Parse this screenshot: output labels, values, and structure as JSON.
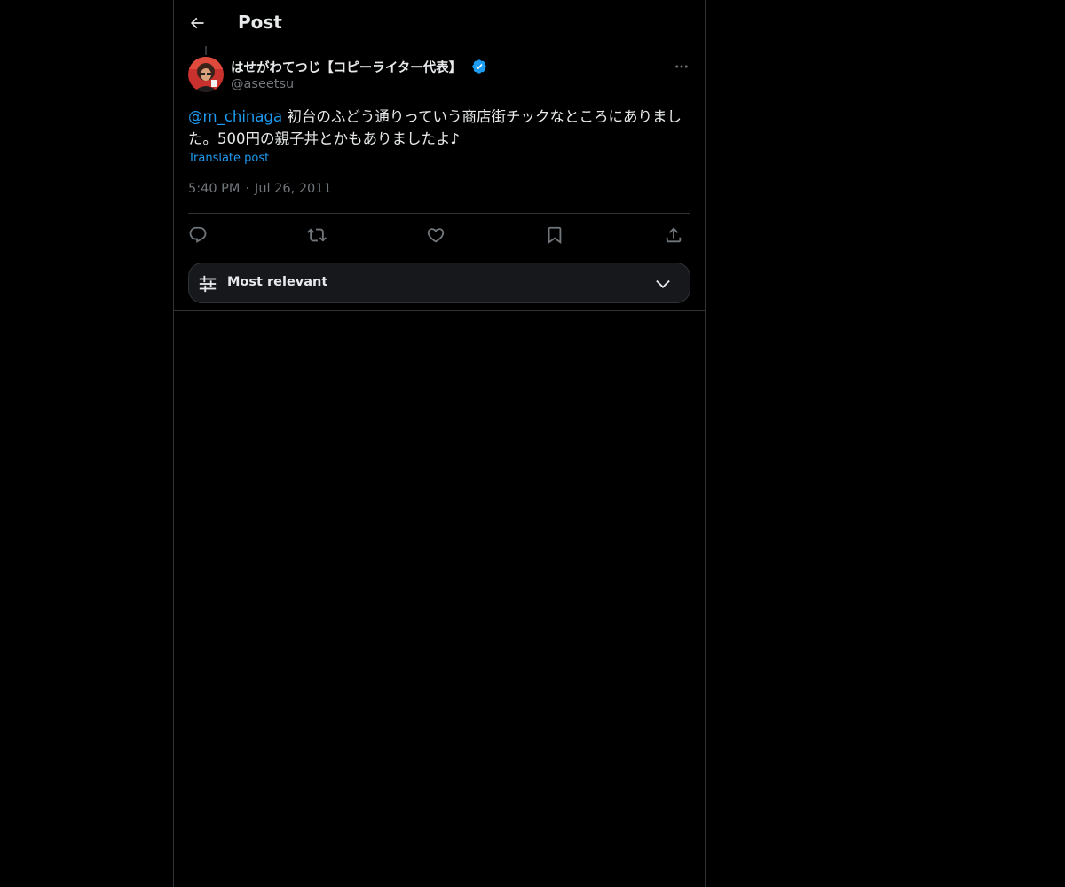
{
  "header": {
    "title": "Post",
    "back_icon": "arrow-left-icon"
  },
  "post": {
    "author_name": "はせがわてつじ【コピーライター代表】",
    "verified": true,
    "handle": "@aseetsu",
    "mention": "@m_chinaga",
    "text_line1": " 初台のふどう通りっていう商店街チックなところにありまし",
    "text_line2": "た。500円の親子丼とかもありましたよ♪",
    "translate_label": "Translate post",
    "time": "5:40 PM",
    "separator": "·",
    "date": "Jul 26, 2011"
  },
  "actions": [
    "reply-icon",
    "repost-icon",
    "like-icon",
    "bookmark-icon",
    "share-icon"
  ],
  "sort": {
    "label": "Most relevant"
  },
  "colors": {
    "accent": "#1d9bf0",
    "background": "#000000",
    "text": "#e7e9ea",
    "muted": "#71767b",
    "border": "#2f3336"
  }
}
